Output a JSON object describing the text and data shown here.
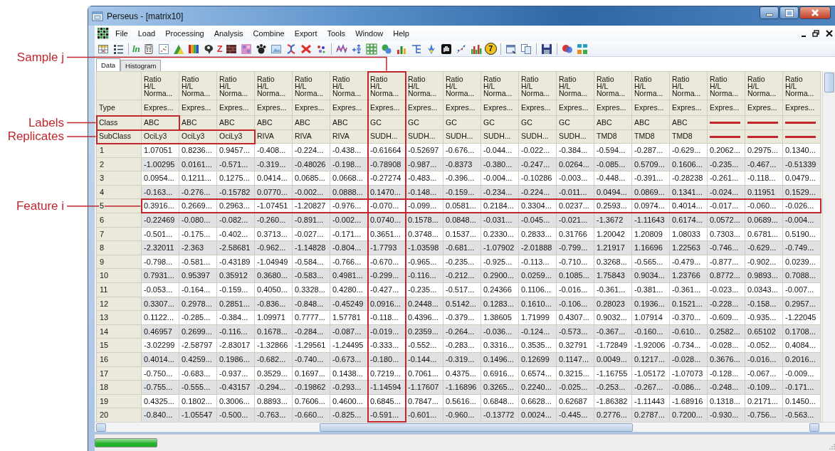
{
  "window": {
    "title": "Perseus - [matrix10]"
  },
  "menu": [
    "File",
    "Load",
    "Processing",
    "Analysis",
    "Combine",
    "Export",
    "Tools",
    "Window",
    "Help"
  ],
  "toolbar": {
    "glyphs": [
      "ln",
      "Z",
      "7"
    ]
  },
  "tabs": [
    {
      "label": "Data",
      "selected": true
    },
    {
      "label": "Histogram",
      "selected": false
    }
  ],
  "table": {
    "columns": [
      {
        "title_lines": [
          "Ratio",
          "H/L",
          "Norma..."
        ],
        "highlighted": false
      },
      {
        "title_lines": [
          "Ratio",
          "H/L",
          "Norma..."
        ],
        "highlighted": false
      },
      {
        "title_lines": [
          "Ratio",
          "H/L",
          "Norma..."
        ],
        "highlighted": false
      },
      {
        "title_lines": [
          "Ratio",
          "H/L",
          "Norma..."
        ],
        "highlighted": false
      },
      {
        "title_lines": [
          "Ratio",
          "H/L",
          "Norma..."
        ],
        "highlighted": false
      },
      {
        "title_lines": [
          "Ratio",
          "H/L",
          "Norma..."
        ],
        "highlighted": false
      },
      {
        "title_lines": [
          "Ratio",
          "H/L",
          "Norma..."
        ],
        "highlighted": true,
        "annotation": "Sample j"
      },
      {
        "title_lines": [
          "Ratio",
          "H/L",
          "Norma..."
        ],
        "highlighted": false
      },
      {
        "title_lines": [
          "Ratio",
          "H/L",
          "Norma..."
        ],
        "highlighted": false
      },
      {
        "title_lines": [
          "Ratio",
          "H/L",
          "Norma..."
        ],
        "highlighted": false
      },
      {
        "title_lines": [
          "Ratio",
          "H/L",
          "Norma..."
        ],
        "highlighted": false
      },
      {
        "title_lines": [
          "Ratio",
          "H/L",
          "Norma..."
        ],
        "highlighted": false
      },
      {
        "title_lines": [
          "Ratio",
          "H/L",
          "Norma..."
        ],
        "highlighted": false
      },
      {
        "title_lines": [
          "Ratio",
          "H/L",
          "Norma..."
        ],
        "highlighted": false
      },
      {
        "title_lines": [
          "Ratio",
          "H/L",
          "Norma..."
        ],
        "highlighted": false
      },
      {
        "title_lines": [
          "Ratio",
          "H/L",
          "Norma..."
        ],
        "highlighted": false
      },
      {
        "title_lines": [
          "Ratio",
          "H/L",
          "Norma..."
        ],
        "highlighted": false
      },
      {
        "title_lines": [
          "Ratio",
          "H/L",
          "Norma..."
        ],
        "highlighted": false
      }
    ],
    "header_rows": [
      {
        "label": "Type",
        "cells": [
          {
            "kind": "text",
            "text": "Expres..."
          },
          {
            "kind": "text",
            "text": "Expres..."
          },
          {
            "kind": "text",
            "text": "Expres..."
          },
          {
            "kind": "text",
            "text": "Expres..."
          },
          {
            "kind": "text",
            "text": "Expres..."
          },
          {
            "kind": "text",
            "text": "Expres..."
          },
          {
            "kind": "text",
            "text": "Expres..."
          },
          {
            "kind": "text",
            "text": "Expres..."
          },
          {
            "kind": "text",
            "text": "Expres..."
          },
          {
            "kind": "text",
            "text": "Expres..."
          },
          {
            "kind": "text",
            "text": "Expres..."
          },
          {
            "kind": "text",
            "text": "Expres..."
          },
          {
            "kind": "text",
            "text": "Expres..."
          },
          {
            "kind": "text",
            "text": "Expres..."
          },
          {
            "kind": "text",
            "text": "Expres..."
          },
          {
            "kind": "text",
            "text": "Expres..."
          },
          {
            "kind": "text",
            "text": "Expres..."
          },
          {
            "kind": "text",
            "text": "Expres..."
          }
        ]
      },
      {
        "label": "Class",
        "annotation": "Labels",
        "cells": [
          {
            "kind": "text",
            "text": "ABC",
            "boxed": true
          },
          {
            "kind": "text",
            "text": "ABC",
            "boxed": false
          },
          {
            "kind": "text",
            "text": "ABC",
            "boxed": false
          },
          {
            "kind": "text",
            "text": "ABC",
            "boxed": false
          },
          {
            "kind": "text",
            "text": "ABC",
            "boxed": false
          },
          {
            "kind": "text",
            "text": "ABC",
            "boxed": false
          },
          {
            "kind": "text",
            "text": "GC",
            "boxed": false
          },
          {
            "kind": "text",
            "text": "GC",
            "boxed": false
          },
          {
            "kind": "text",
            "text": "GC",
            "boxed": false
          },
          {
            "kind": "text",
            "text": "GC",
            "boxed": false
          },
          {
            "kind": "text",
            "text": "GC",
            "boxed": false
          },
          {
            "kind": "text",
            "text": "GC",
            "boxed": false
          },
          {
            "kind": "text",
            "text": "ABC",
            "boxed": false
          },
          {
            "kind": "text",
            "text": "ABC",
            "boxed": false
          },
          {
            "kind": "text",
            "text": "ABC",
            "boxed": false
          },
          {
            "kind": "dash",
            "boxed": false
          },
          {
            "kind": "dash",
            "boxed": false
          },
          {
            "kind": "dash",
            "boxed": false
          }
        ]
      },
      {
        "label": "SubClass",
        "annotation": "Replicates",
        "cells": [
          {
            "kind": "text",
            "text": "OciLy3",
            "boxed": true
          },
          {
            "kind": "text",
            "text": "OciLy3",
            "boxed": true
          },
          {
            "kind": "text",
            "text": "OciLy3",
            "boxed": true
          },
          {
            "kind": "text",
            "text": "RIVA",
            "boxed": false
          },
          {
            "kind": "text",
            "text": "RIVA",
            "boxed": false
          },
          {
            "kind": "text",
            "text": "RIVA",
            "boxed": false
          },
          {
            "kind": "text",
            "text": "SUDH...",
            "boxed": false
          },
          {
            "kind": "text",
            "text": "SUDH...",
            "boxed": false
          },
          {
            "kind": "text",
            "text": "SUDH...",
            "boxed": false
          },
          {
            "kind": "text",
            "text": "SUDH...",
            "boxed": false
          },
          {
            "kind": "text",
            "text": "SUDH...",
            "boxed": false
          },
          {
            "kind": "text",
            "text": "SUDH...",
            "boxed": false
          },
          {
            "kind": "text",
            "text": "TMD8",
            "boxed": false
          },
          {
            "kind": "text",
            "text": "TMD8",
            "boxed": false
          },
          {
            "kind": "text",
            "text": "TMD8",
            "boxed": false
          },
          {
            "kind": "dash",
            "boxed": false
          },
          {
            "kind": "dash",
            "boxed": false
          },
          {
            "kind": "dash",
            "boxed": false
          }
        ]
      }
    ],
    "rows": [
      {
        "label": "1",
        "highlighted": false,
        "cells": [
          "1.07051",
          "0.8236...",
          "0.9457...",
          "-0.408...",
          "-0.224...",
          "-0.438...",
          "-0.61664",
          "-0.52697",
          "-0.676...",
          "-0.044...",
          "-0.022...",
          "-0.384...",
          "-0.594...",
          "-0.287...",
          "-0.629...",
          "0.2062...",
          "0.2975...",
          "0.1340..."
        ]
      },
      {
        "label": "2",
        "highlighted": false,
        "cells": [
          "-1.00295",
          "0.0161...",
          "-0.571...",
          "-0.319...",
          "-0.48026",
          "-0.198...",
          "-0.78908",
          "-0.987...",
          "-0.8373",
          "-0.380...",
          "-0.247...",
          "0.0264...",
          "-0.085...",
          "0.5709...",
          "0.1606...",
          "-0.235...",
          "-0.467...",
          "-0.51339"
        ]
      },
      {
        "label": "3",
        "highlighted": false,
        "cells": [
          "0.0954...",
          "0.1211...",
          "0.1275...",
          "0.0414...",
          "0.0685...",
          "0.0668...",
          "-0.27274",
          "-0.483...",
          "-0.396...",
          "-0.004...",
          "-0.10286",
          "-0.003...",
          "-0.448...",
          "-0.391...",
          "-0.28238",
          "-0.261...",
          "-0.118...",
          "0.0479..."
        ]
      },
      {
        "label": "4",
        "highlighted": false,
        "cells": [
          "-0.163...",
          "-0.276...",
          "-0.15782",
          "0.0770...",
          "-0.002...",
          "0.0888...",
          "0.1470...",
          "-0.148...",
          "-0.159...",
          "-0.234...",
          "-0.224...",
          "-0.011...",
          "0.0494...",
          "0.0869...",
          "0.1341...",
          "-0.024...",
          "0.11951",
          "0.1529..."
        ]
      },
      {
        "label": "5",
        "highlighted": true,
        "annotation": "Feature i",
        "cells": [
          "0.3916...",
          "0.2669...",
          "0.2963...",
          "-1.07451",
          "-1.20827",
          "-0.976...",
          "-0.070...",
          "-0.099...",
          "0.0581...",
          "0.2184...",
          "0.3304...",
          "0.0237...",
          "0.2593...",
          "0.0974...",
          "0.4014...",
          "-0.017...",
          "-0.060...",
          "-0.026..."
        ]
      },
      {
        "label": "6",
        "highlighted": false,
        "cells": [
          "-0.22469",
          "-0.080...",
          "-0.082...",
          "-0.260...",
          "-0.891...",
          "-0.002...",
          "0.0740...",
          "0.1578...",
          "0.0848...",
          "-0.031...",
          "-0.045...",
          "-0.021...",
          "-1.3672",
          "-1.11643",
          "0.6174...",
          "0.0572...",
          "0.0689...",
          "-0.004..."
        ]
      },
      {
        "label": "7",
        "highlighted": false,
        "cells": [
          "-0.501...",
          "-0.175...",
          "-0.402...",
          "0.3713...",
          "-0.027...",
          "-0.171...",
          "0.3651...",
          "0.3748...",
          "0.1537...",
          "0.2330...",
          "0.2833...",
          "0.31766",
          "1.20042",
          "1.20809",
          "1.08033",
          "0.7303...",
          "0.6781...",
          "0.5190..."
        ]
      },
      {
        "label": "8",
        "highlighted": false,
        "cells": [
          "-2.32011",
          "-2.363",
          "-2.58681",
          "-0.962...",
          "-1.14828",
          "-0.804...",
          "-1.7793",
          "-1.03598",
          "-0.681...",
          "-1.07902",
          "-2.01888",
          "-0.799...",
          "1.21917",
          "1.16696",
          "1.22563",
          "-0.746...",
          "-0.629...",
          "-0.749..."
        ]
      },
      {
        "label": "9",
        "highlighted": false,
        "cells": [
          "-0.798...",
          "-0.581...",
          "-0.43189",
          "-1.04949",
          "-0.584...",
          "-0.766...",
          "-0.670...",
          "-0.965...",
          "-0.235...",
          "-0.925...",
          "-0.113...",
          "-0.710...",
          "0.3268...",
          "-0.565...",
          "-0.479...",
          "-0.877...",
          "-0.902...",
          "0.0239..."
        ]
      },
      {
        "label": "10",
        "highlighted": false,
        "cells": [
          "0.7931...",
          "0.95397",
          "0.35912",
          "0.3680...",
          "-0.583...",
          "0.4981...",
          "-0.299...",
          "-0.116...",
          "-0.212...",
          "0.2900...",
          "0.0259...",
          "0.1085...",
          "1.75843",
          "0.9034...",
          "1.23766",
          "0.8772...",
          "0.9893...",
          "0.7088..."
        ]
      },
      {
        "label": "11",
        "highlighted": false,
        "cells": [
          "-0.053...",
          "-0.164...",
          "-0.159...",
          "0.4050...",
          "0.3328...",
          "0.4280...",
          "-0.427...",
          "-0.235...",
          "-0.517...",
          "0.24366",
          "0.1106...",
          "-0.016...",
          "-0.361...",
          "-0.381...",
          "-0.361...",
          "-0.023...",
          "0.0343...",
          "-0.007..."
        ]
      },
      {
        "label": "12",
        "highlighted": false,
        "cells": [
          "0.3307...",
          "0.2978...",
          "0.2851...",
          "-0.836...",
          "-0.848...",
          "-0.45249",
          "0.0916...",
          "0.2448...",
          "0.5142...",
          "0.1283...",
          "0.1610...",
          "-0.106...",
          "0.28023",
          "0.1936...",
          "0.1521...",
          "-0.228...",
          "-0.158...",
          "0.2957..."
        ]
      },
      {
        "label": "13",
        "highlighted": false,
        "cells": [
          "0.1122...",
          "-0.285...",
          "-0.384...",
          "1.09971",
          "0.7777...",
          "1.57781",
          "-0.118...",
          "0.4396...",
          "-0.379...",
          "1.38605",
          "1.71999",
          "0.4307...",
          "0.9032...",
          "1.07914",
          "-0.370...",
          "-0.609...",
          "-0.935...",
          "-1.22045"
        ]
      },
      {
        "label": "14",
        "highlighted": false,
        "cells": [
          "0.46957",
          "0.2699...",
          "-0.116...",
          "0.1678...",
          "-0.284...",
          "-0.087...",
          "-0.019...",
          "0.2359...",
          "-0.264...",
          "-0.036...",
          "-0.124...",
          "-0.573...",
          "-0.367...",
          "-0.160...",
          "-0.610...",
          "0.2582...",
          "0.65102",
          "0.1708..."
        ]
      },
      {
        "label": "15",
        "highlighted": false,
        "cells": [
          "-3.02299",
          "-2.58797",
          "-2.83017",
          "-1.32866",
          "-1.29561",
          "-1.24495",
          "-0.333...",
          "-0.552...",
          "-0.283...",
          "0.3316...",
          "0.3535...",
          "0.32791",
          "-1.72849",
          "-1.92006",
          "-0.734...",
          "-0.028...",
          "-0.052...",
          "0.4084..."
        ]
      },
      {
        "label": "16",
        "highlighted": false,
        "cells": [
          "0.4014...",
          "0.4259...",
          "0.1986...",
          "-0.682...",
          "-0.740...",
          "-0.673...",
          "-0.180...",
          "-0.144...",
          "-0.319...",
          "0.1496...",
          "0.12699",
          "0.1147...",
          "0.0049...",
          "0.1217...",
          "-0.028...",
          "0.3676...",
          "-0.016...",
          "0.2016..."
        ]
      },
      {
        "label": "17",
        "highlighted": false,
        "cells": [
          "-0.750...",
          "-0.683...",
          "-0.937...",
          "0.3529...",
          "0.1697...",
          "0.1438...",
          "0.7219...",
          "0.7061...",
          "0.4375...",
          "0.6916...",
          "0.6574...",
          "0.3215...",
          "-1.16755",
          "-1.05172",
          "-1.07073",
          "-0.128...",
          "-0.067...",
          "-0.009..."
        ]
      },
      {
        "label": "18",
        "highlighted": false,
        "cells": [
          "-0.755...",
          "-0.555...",
          "-0.43157",
          "-0.294...",
          "-0.19862",
          "-0.293...",
          "-1.14594",
          "-1.17607",
          "-1.16896",
          "0.3265...",
          "0.2240...",
          "-0.025...",
          "-0.253...",
          "-0.267...",
          "-0.086...",
          "-0.248...",
          "-0.109...",
          "-0.171..."
        ]
      },
      {
        "label": "19",
        "highlighted": false,
        "cells": [
          "0.4325...",
          "0.1802...",
          "0.3006...",
          "0.8893...",
          "0.7606...",
          "0.4600...",
          "0.6845...",
          "0.7847...",
          "0.5616...",
          "0.6848...",
          "0.6628...",
          "0.62687",
          "-1.86382",
          "-1.11443",
          "-1.68916",
          "0.1318...",
          "0.2171...",
          "0.1450..."
        ]
      },
      {
        "label": "20",
        "highlighted": false,
        "cells": [
          "-0.840...",
          "-1.05547",
          "-0.500...",
          "-0.763...",
          "-0.660...",
          "-0.825...",
          "-0.591...",
          "-0.601...",
          "-0.960...",
          "-0.13772",
          "0.0024...",
          "-0.445...",
          "0.2776...",
          "0.2787...",
          "0.7200...",
          "-0.930...",
          "-0.756...",
          "-0.563..."
        ]
      }
    ]
  },
  "status_bar": {
    "progress": {
      "level": 1
    }
  }
}
